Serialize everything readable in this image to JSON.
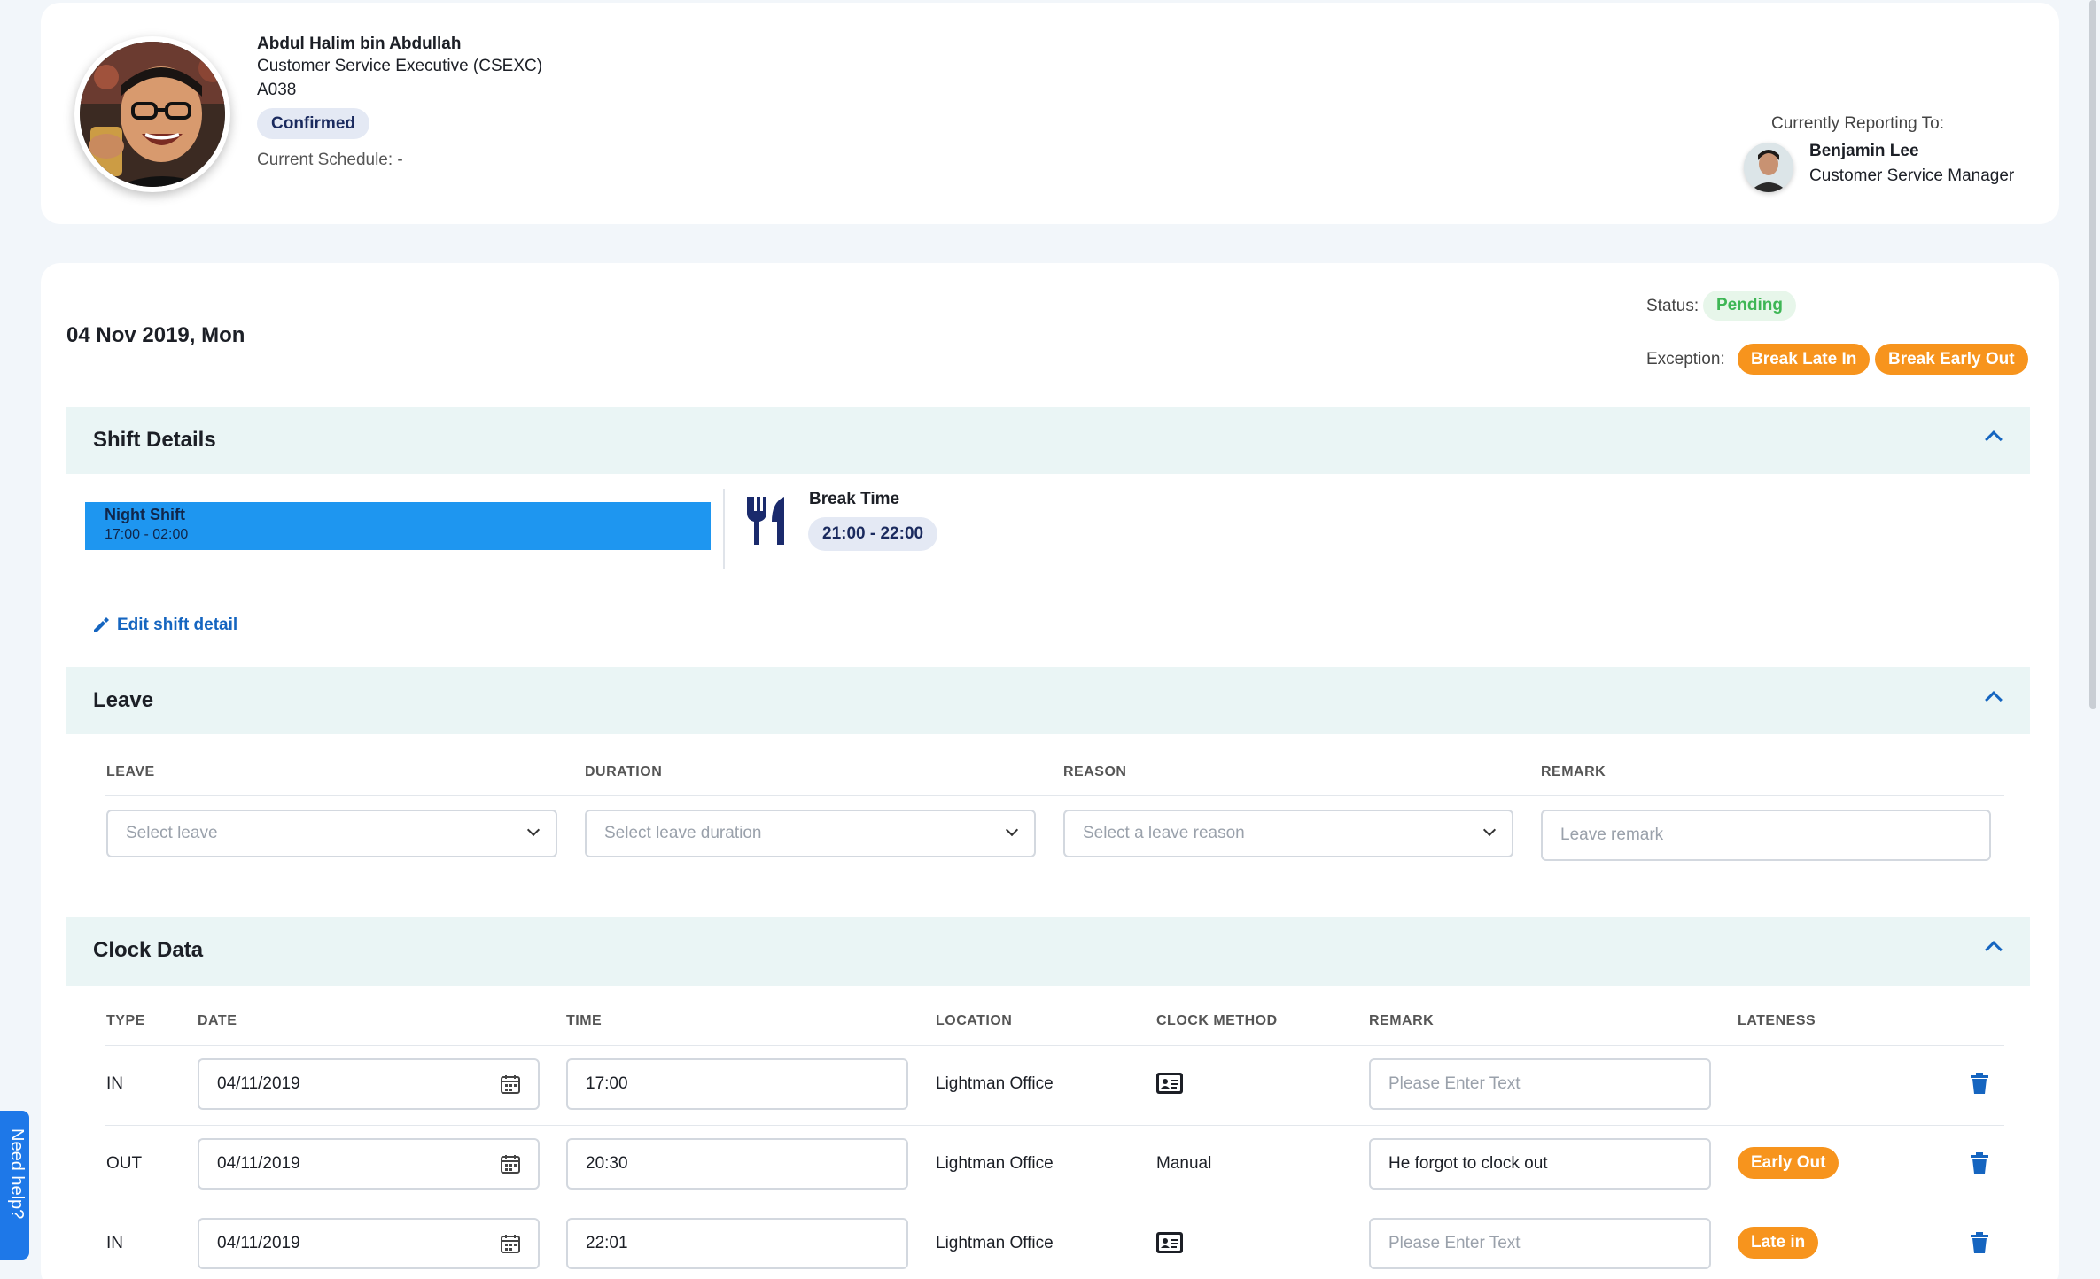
{
  "profile": {
    "name": "Abdul Halim bin Abdullah",
    "role": "Customer Service Executive (CSEXC)",
    "employee_id": "A038",
    "status": "Confirmed",
    "schedule": "Current Schedule: -",
    "reporting_label": "Currently Reporting To:",
    "manager_name": "Benjamin Lee",
    "manager_role": "Customer Service Manager"
  },
  "day": {
    "date": "04 Nov 2019, Mon",
    "status_label": "Status:",
    "status_value": "Pending",
    "exception_label": "Exception:",
    "exceptions": [
      "Break Late In",
      "Break Early Out"
    ]
  },
  "shift_details": {
    "title": "Shift Details",
    "shift_name": "Night Shift",
    "shift_time": "17:00 - 02:00",
    "break_label": "Break Time",
    "break_time": "21:00 - 22:00",
    "edit_label": "Edit shift detail"
  },
  "leave": {
    "title": "Leave",
    "columns": [
      "LEAVE",
      "DURATION",
      "REASON",
      "REMARK"
    ],
    "leave_placeholder": "Select leave",
    "duration_placeholder": "Select leave duration",
    "reason_placeholder": "Select a leave reason",
    "remark_placeholder": "Leave remark"
  },
  "clock_data": {
    "title": "Clock Data",
    "columns": [
      "TYPE",
      "DATE",
      "TIME",
      "LOCATION",
      "CLOCK METHOD",
      "REMARK",
      "LATENESS"
    ],
    "rows": [
      {
        "type": "IN",
        "date": "04/11/2019",
        "time": "17:00",
        "location": "Lightman Office",
        "method": "card-icon",
        "remark": "",
        "remark_placeholder": "Please Enter Text",
        "lateness": ""
      },
      {
        "type": "OUT",
        "date": "04/11/2019",
        "time": "20:30",
        "location": "Lightman Office",
        "method": "Manual",
        "remark": "He forgot to clock out",
        "remark_placeholder": "Please Enter Text",
        "lateness": "Early Out"
      },
      {
        "type": "IN",
        "date": "04/11/2019",
        "time": "22:01",
        "location": "Lightman Office",
        "method": "card-icon",
        "remark": "",
        "remark_placeholder": "Please Enter Text",
        "lateness": "Late in"
      }
    ]
  },
  "help": {
    "label": "Need help?"
  },
  "colors": {
    "accent_blue": "#1565c0",
    "shift_bar": "#1e96f0",
    "warning_orange": "#f7941d",
    "pending_green": "#3eb655",
    "section_bg": "#eaf5f5"
  }
}
